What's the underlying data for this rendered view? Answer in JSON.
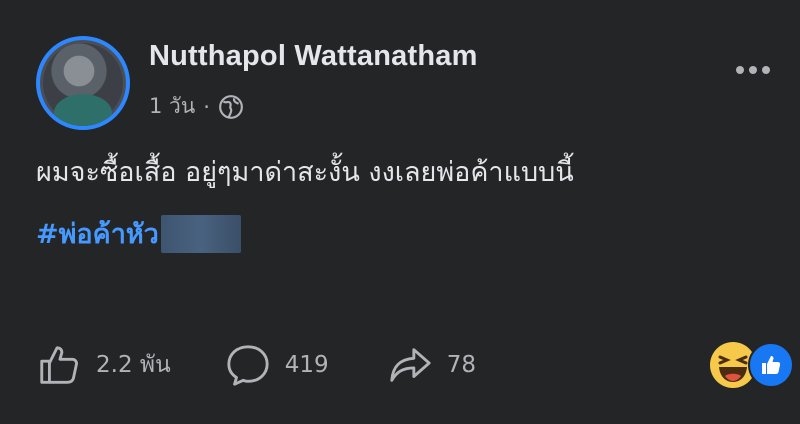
{
  "post": {
    "author": "Nutthapol Wattanatham",
    "time": "1 วัน",
    "separator": "·",
    "text": "ผมจะซื้อเสื้อ อยู่ๆมาด่าสะงั้น งงเลยพ่อค้าแบบนี้",
    "hashtag": "#พ่อค้าหัว"
  },
  "actions": {
    "likes": "2.2 พัน",
    "comments": "419",
    "shares": "78"
  },
  "icons": {
    "privacy": "globe-icon",
    "menu": "more-options-icon",
    "like": "thumbs-up-icon",
    "comment": "comment-bubble-icon",
    "share": "share-arrow-icon",
    "reaction_1": "haha-reaction-icon",
    "reaction_2": "like-reaction-icon"
  },
  "colors": {
    "background": "#242526",
    "text": "#e4e6eb",
    "secondary": "#b0b3b8",
    "hashtag": "#4599ff",
    "avatar_ring": "#2d88ff",
    "like_blue": "#1877f2"
  }
}
